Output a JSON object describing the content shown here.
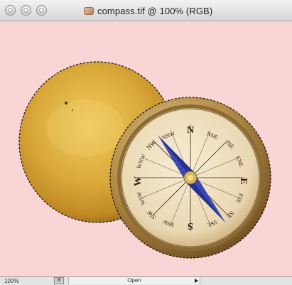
{
  "window": {
    "title": "compass.tif @ 100% (RGB)",
    "controls": [
      "close-button",
      "minimize-button",
      "zoom-button"
    ]
  },
  "canvas": {
    "background": "#f9d5d6",
    "lid_color": "#e0b23c",
    "compass_face_color": "#f1e1c5",
    "needle_color": "#27318f",
    "compass_labels": {
      "north": "N",
      "north_northwest": "NNW",
      "north_northeast": "NNE",
      "northwest": "NW",
      "northeast": "NE",
      "west_northwest": "WNW",
      "east_northeast": "ENE",
      "west": "W",
      "east": "E",
      "west_southwest": "WSW",
      "east_southeast": "ESE",
      "southwest": "SW",
      "southeast": "SE",
      "south_southwest": "SSW",
      "south_southeast": "SSE",
      "south": "S"
    }
  },
  "statusbar": {
    "zoom": "100%",
    "nav_icon": "navigate-icon",
    "info": "Open",
    "arrow_icon": "triangle-right-icon"
  }
}
